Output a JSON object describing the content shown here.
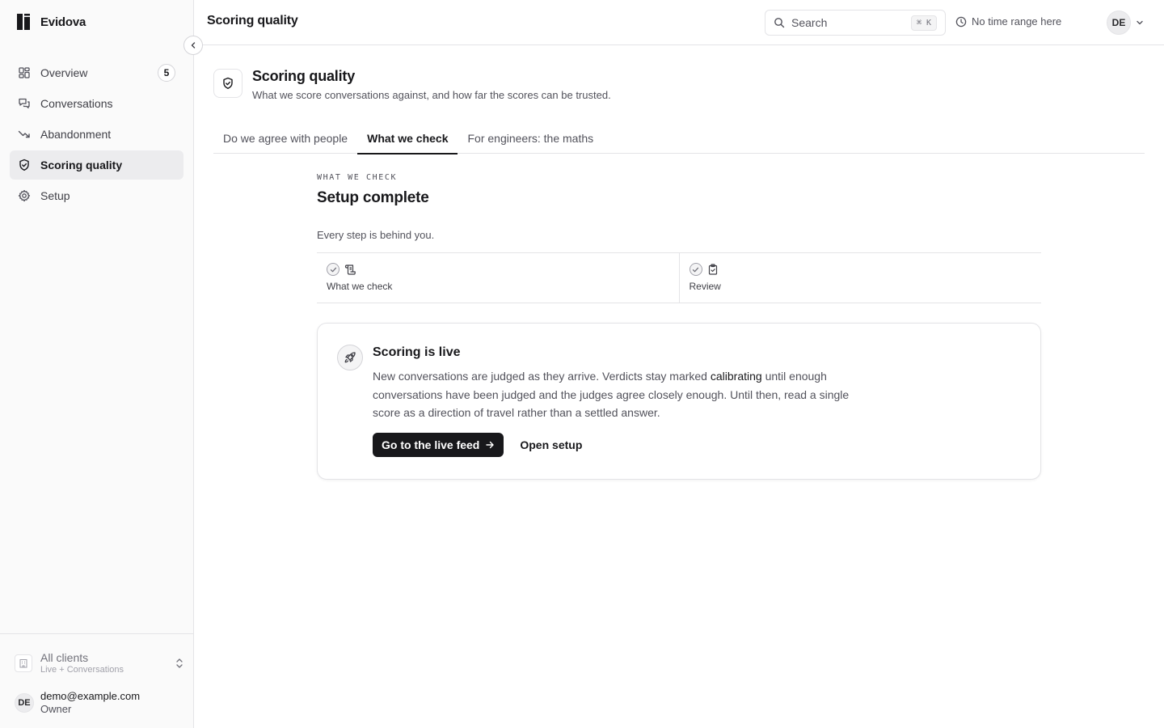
{
  "brand": {
    "name": "Evidova"
  },
  "sidebar": {
    "items": [
      {
        "label": "Overview",
        "badge": "5"
      },
      {
        "label": "Conversations"
      },
      {
        "label": "Abandonment"
      },
      {
        "label": "Scoring quality"
      },
      {
        "label": "Setup"
      }
    ],
    "active_index": 3
  },
  "client": {
    "name": "All clients",
    "sub": "Live + Conversations"
  },
  "user": {
    "initials": "DE",
    "email": "demo@example.com",
    "role": "Owner"
  },
  "header": {
    "title": "Scoring quality",
    "search_label": "Search",
    "search_shortcut": "⌘ K",
    "time_range": "No time range here",
    "avatar_initials": "DE"
  },
  "page": {
    "title": "Scoring quality",
    "subtitle": "What we score conversations against, and how far the scores can be trusted."
  },
  "tabs": [
    {
      "label": "Do we agree with people"
    },
    {
      "label": "What we check"
    },
    {
      "label": "For engineers: the maths"
    }
  ],
  "active_tab": 1,
  "section": {
    "eyebrow": "WHAT WE CHECK",
    "title": "Setup complete",
    "description": "Every step is behind you."
  },
  "steps": [
    {
      "label": "What we check"
    },
    {
      "label": "Review"
    }
  ],
  "card": {
    "title": "Scoring is live",
    "text_before": "New conversations are judged as they arrive. Verdicts stay marked ",
    "text_emph": "calibrating",
    "text_after": " until enough conversations have been judged and the judges agree closely enough. Until then, read a single score as a direction of travel rather than a settled answer.",
    "primary_label": "Go to the live feed",
    "secondary_label": "Open setup"
  }
}
